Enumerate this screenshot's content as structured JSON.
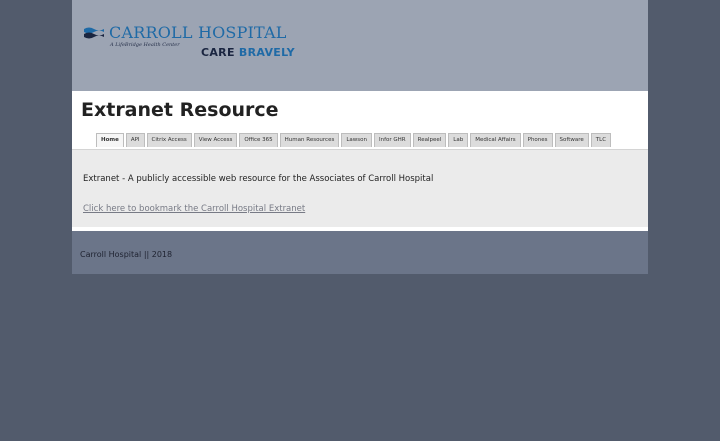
{
  "header": {
    "logo_name": "CARROLL HOSPITAL",
    "logo_subtitle": "A LifeBridge Health Center",
    "tagline_word1": "CARE",
    "tagline_word2": "BRAVELY"
  },
  "page_title": "Extranet Resource",
  "tabs": [
    {
      "label": "Home",
      "active": true
    },
    {
      "label": "API"
    },
    {
      "label": "Citrix Access"
    },
    {
      "label": "View Access"
    },
    {
      "label": "Office 365"
    },
    {
      "label": "Human Resources"
    },
    {
      "label": "Lawson"
    },
    {
      "label": "Infor GHR"
    },
    {
      "label": "Realpeel"
    },
    {
      "label": "Lab"
    },
    {
      "label": "Medical Affairs"
    },
    {
      "label": "Phones"
    },
    {
      "label": "Software"
    },
    {
      "label": "TLC"
    }
  ],
  "main": {
    "description": "Extranet - A publicly accessible web resource for the Associates of Carroll Hospital",
    "bookmark_link": "Click here to bookmark the Carroll Hospital Extranet"
  },
  "footer": {
    "text": "Carroll Hospital || 2018"
  },
  "colors": {
    "background": "#525b6c",
    "header_bg": "#9ca4b3",
    "footer_bg": "#6b7589",
    "brand_blue": "#1f6aa6",
    "brand_navy": "#1a2540"
  }
}
